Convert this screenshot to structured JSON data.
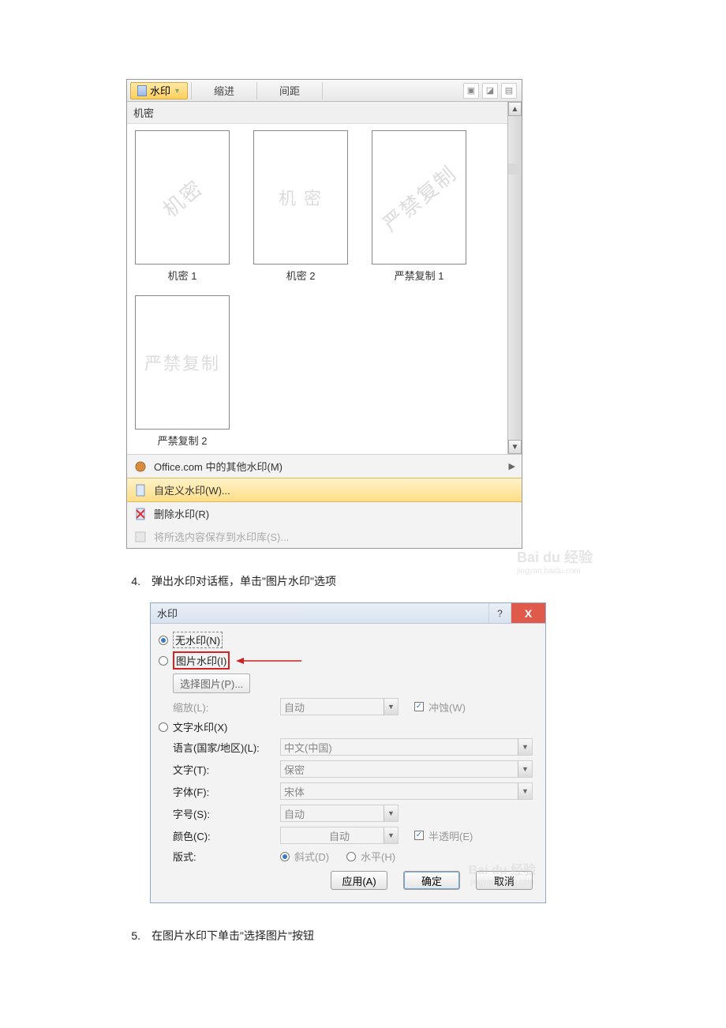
{
  "screenshot1": {
    "ribbon": {
      "watermark_btn": "水印",
      "indent": "缩进",
      "spacing": "间距"
    },
    "gallery_header": "机密",
    "items": [
      {
        "text": "机密",
        "caption": "机密 1",
        "cls": "wm-text"
      },
      {
        "text": "机 密",
        "caption": "机密 2",
        "cls": "wm-text wm-text-h"
      },
      {
        "text": "严禁复制",
        "caption": "严禁复制 1",
        "cls": "wm-text"
      },
      {
        "text": "严禁复制",
        "caption": "严禁复制 2",
        "cls": "wm-text wm-text-h"
      }
    ],
    "menu": {
      "more": "Office.com 中的其他水印(M)",
      "custom": "自定义水印(W)...",
      "remove": "删除水印(R)",
      "save": "将所选内容保存到水印库(S)..."
    },
    "baidu": {
      "title": "Bai du 经验",
      "sub": "jingyan.baidu.com"
    }
  },
  "step4": {
    "num": "4.",
    "text": "弹出水印对话框，单击\"图片水印\"选项"
  },
  "dialog": {
    "title": "水印",
    "radios": {
      "none": "无水印(N)",
      "picture": "图片水印(I)",
      "text": "文字水印(X)"
    },
    "select_pic": "选择图片(P)...",
    "labels": {
      "scale": "缩放(L):",
      "washout": "冲蚀(W)",
      "language": "语言(国家/地区)(L):",
      "text": "文字(T):",
      "font": "字体(F):",
      "size": "字号(S):",
      "color": "颜色(C):",
      "translucent": "半透明(E)",
      "layout": "版式:",
      "diagonal": "斜式(D)",
      "horizontal": "水平(H)"
    },
    "values": {
      "scale": "自动",
      "language": "中文(中国)",
      "text": "保密",
      "font": "宋体",
      "size": "自动",
      "color": "自动"
    },
    "buttons": {
      "apply": "应用(A)",
      "ok": "确定",
      "cancel": "取消"
    },
    "baidu": {
      "title": "Bai du 经验",
      "sub": "jingyan.baidu.com"
    }
  },
  "step5": {
    "num": "5.",
    "text": "在图片水印下单击\"选择图片\"按钮"
  }
}
